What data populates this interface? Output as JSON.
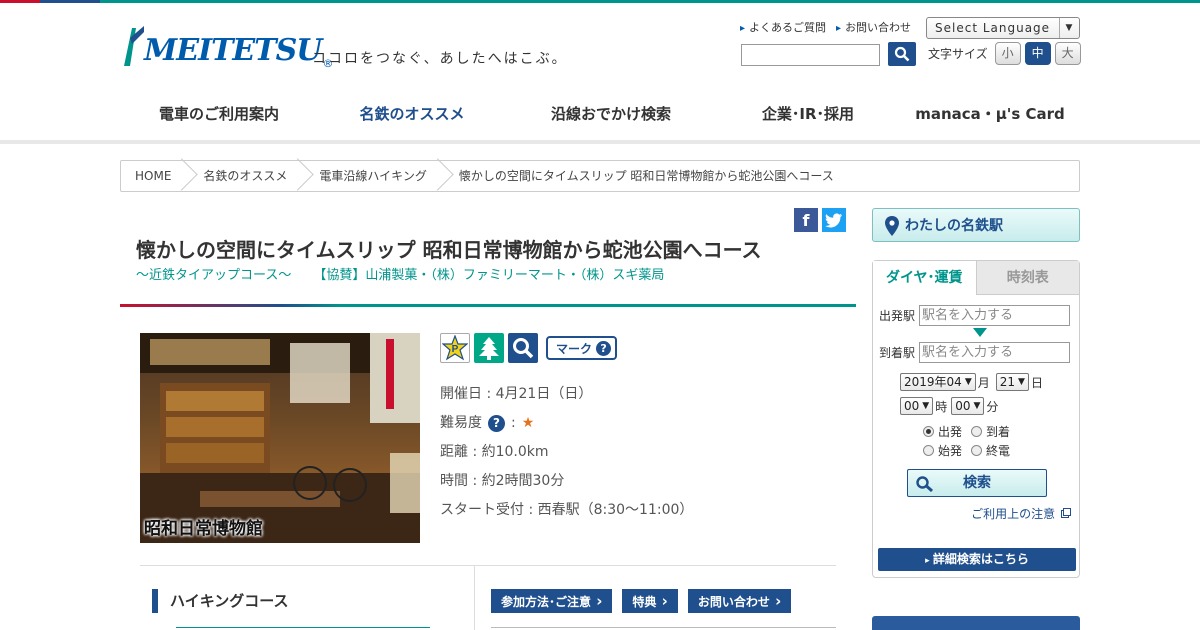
{
  "colors": {
    "top_bar": [
      "#c8102e",
      "#1f4f8c",
      "#00958c"
    ],
    "brand_blue": "#1f4f8c",
    "accent_teal": "#00958c"
  },
  "header": {
    "logo_text": "MEITETSU",
    "logo_reg": "®",
    "tagline": "ココロをつなぐ、あしたへはこぶ。",
    "links": [
      "よくあるご質問",
      "お問い合わせ"
    ],
    "language_label": "Select Language",
    "font_size_label": "文字サイズ",
    "font_sizes": [
      "小",
      "中",
      "大"
    ]
  },
  "nav": {
    "items": [
      "電車のご利用案内",
      "名鉄のオススメ",
      "沿線おでかけ検索",
      "企業･IR･採用",
      "manaca・μ's Card"
    ]
  },
  "breadcrumb": [
    "HOME",
    "名鉄のオススメ",
    "電車沿線ハイキング",
    "懐かしの空間にタイムスリップ 昭和日常博物館から蛇池公園へコース"
  ],
  "page": {
    "title": "懐かしの空間にタイムスリップ 昭和日常博物館から蛇池公園へコース",
    "subtitle": "～近鉄タイアップコース～",
    "sponsor": "【協賛】山浦製菓・（株）ファミリーマート・（株）スギ薬局"
  },
  "photo_caption": "昭和日常博物館",
  "marks": {
    "icons": [
      "parking-icon",
      "tree-icon",
      "search-icon"
    ],
    "button_label": "マーク"
  },
  "details": {
    "date": "開催日 : 4月21日（日）",
    "difficulty_label": "難易度",
    "difficulty_sep": ":",
    "difficulty_stars": "★",
    "distance": "距離 : 約10.0km",
    "time": "時間 : 約2時間30分",
    "start": "スタート受付 : 西春駅（8:30～11:00）"
  },
  "course_heading": "ハイキングコース",
  "tabs": [
    "参加方法･ご注意",
    "特典",
    "お問い合わせ"
  ],
  "sidebar": {
    "my_station": "わたしの名鉄駅",
    "dia_tab": "ダイヤ･運賃",
    "timetable_tab": "時刻表",
    "from_label": "出発駅",
    "to_label": "到着駅",
    "station_placeholder": "駅名を入力する",
    "year": "2019年04",
    "month_unit": "月",
    "day": "21",
    "day_unit": "日",
    "hour": "00",
    "hour_unit": "時",
    "minute": "00",
    "minute_unit": "分",
    "radios": [
      {
        "label": "出発",
        "checked": true
      },
      {
        "label": "到着",
        "checked": false
      },
      {
        "label": "始発",
        "checked": false
      },
      {
        "label": "終電",
        "checked": false
      }
    ],
    "search_label": "検索",
    "notice_label": "ご利用上の注意",
    "detail_label": "詳細検索はこちら"
  }
}
